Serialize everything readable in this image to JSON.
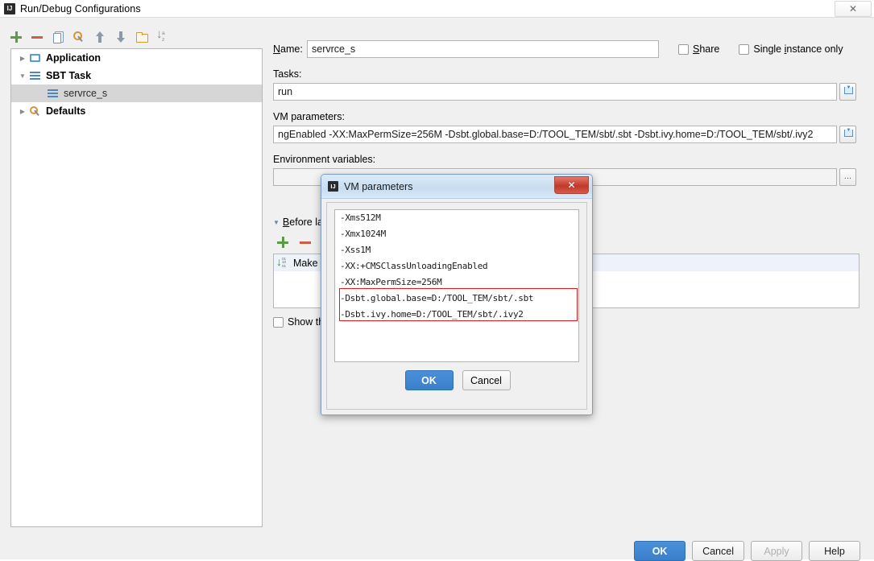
{
  "window": {
    "title": "Run/Debug Configurations",
    "app_icon": "intellij-icon",
    "close_label": "✕"
  },
  "toolbar": {
    "icons": [
      {
        "name": "add-icon",
        "label": "+"
      },
      {
        "name": "remove-icon",
        "label": "−"
      },
      {
        "name": "copy-icon",
        "label": "copy"
      },
      {
        "name": "edit-defaults-icon",
        "label": "defaults"
      },
      {
        "name": "move-up-icon",
        "label": "up"
      },
      {
        "name": "move-down-icon",
        "label": "down"
      },
      {
        "name": "folder-icon",
        "label": "folder"
      },
      {
        "name": "sort-alphabetically-icon",
        "label": "sort"
      }
    ]
  },
  "tree": {
    "items": [
      {
        "label": "Application",
        "icon": "application-icon",
        "expanded": false,
        "level": 0,
        "selected": false,
        "arrow": "▶"
      },
      {
        "label": "SBT Task",
        "icon": "sbt-task-icon",
        "expanded": true,
        "level": 0,
        "selected": false,
        "arrow": "▼"
      },
      {
        "label": "servrce_s",
        "icon": "sbt-task-icon",
        "level": 1,
        "selected": true,
        "arrow": ""
      },
      {
        "label": "Defaults",
        "icon": "defaults-icon",
        "expanded": false,
        "level": 0,
        "selected": false,
        "arrow": "▶"
      }
    ]
  },
  "form": {
    "name_label": "Name:",
    "name_value": "servrce_s",
    "share_label": "Share",
    "share_checked": false,
    "single_instance_label": "Single instance only",
    "single_instance_checked": false,
    "tasks_label": "Tasks:",
    "tasks_value": "run",
    "vm_label": "VM parameters:",
    "vm_value": "ngEnabled -XX:MaxPermSize=256M -Dsbt.global.base=D:/TOOL_TEM/sbt/.sbt -Dsbt.ivy.home=D:/TOOL_TEM/sbt/.ivy2",
    "env_label": "Environment variables:",
    "env_value": "",
    "env_browse_label": "...",
    "expand_button_name": "expand-field-button"
  },
  "before_launch": {
    "title": "Before launch",
    "caret": "▼",
    "add_label": "+",
    "remove_label": "−",
    "items": [
      {
        "label": "Make",
        "icon": "make-icon",
        "selected": true
      }
    ],
    "show_checkbox_label": "Show this page",
    "show_checkbox_checked": false
  },
  "footer": {
    "ok": "OK",
    "cancel": "Cancel",
    "apply": "Apply",
    "apply_disabled": true,
    "help": "Help"
  },
  "vm_dialog": {
    "title": "VM parameters",
    "icon": "intellij-icon",
    "close_label": "✕",
    "lines": [
      "-Xms512M",
      "-Xmx1024M",
      "-Xss1M",
      "-XX:+CMSClassUnloadingEnabled",
      "-XX:MaxPermSize=256M",
      "-Dsbt.global.base=D:/TOOL_TEM/sbt/.sbt",
      "-Dsbt.ivy.home=D:/TOOL_TEM/sbt/.ivy2"
    ],
    "highlight_color": "#e01b1b",
    "highlight_lines": [
      5,
      6
    ],
    "ok": "OK",
    "cancel": "Cancel"
  },
  "colors": {
    "accent": "#3b7fca",
    "window_bg": "#f0f0f0",
    "selection": "#d6d6d6",
    "list_selection": "#eef3fb",
    "annotation_red": "#e01b1b",
    "close_red": "#c0392b"
  }
}
